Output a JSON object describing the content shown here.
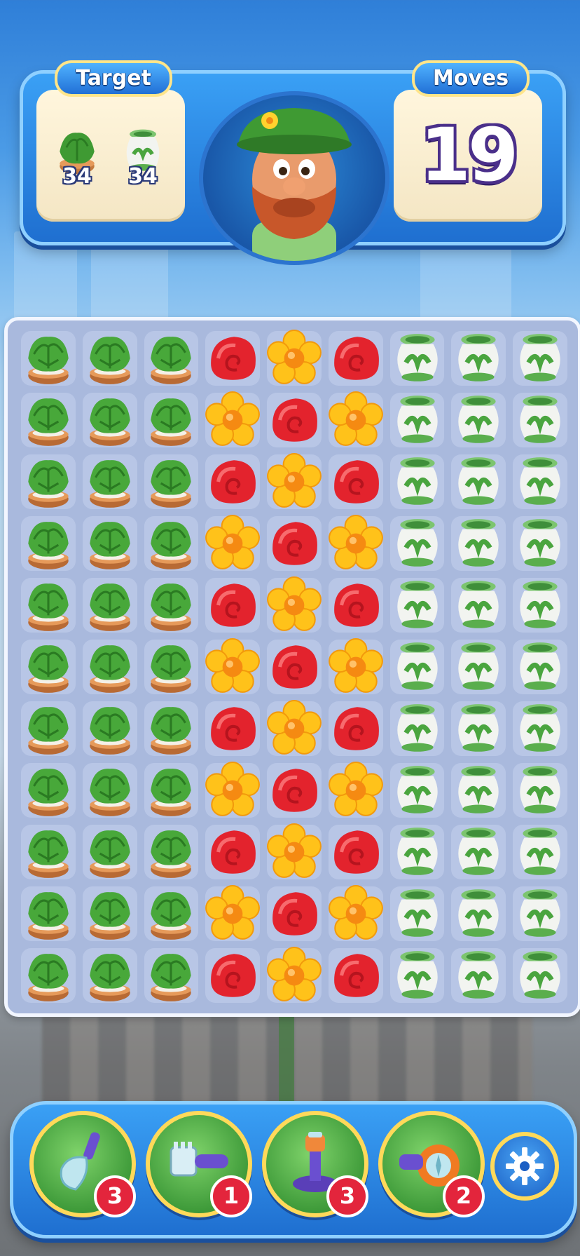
{
  "header": {
    "target_label": "Target",
    "moves_label": "Moves",
    "moves_value": "19",
    "targets": [
      {
        "icon": "potted-plant-icon",
        "count": "34"
      },
      {
        "icon": "green-vase-icon",
        "count": "34"
      }
    ]
  },
  "board": {
    "rows": 11,
    "cols": 9,
    "pattern": [
      [
        "plant",
        "plant",
        "plant",
        "red",
        "yellow",
        "red",
        "vase",
        "vase",
        "vase"
      ],
      [
        "plant",
        "plant",
        "plant",
        "yellow",
        "red",
        "yellow",
        "vase",
        "vase",
        "vase"
      ],
      [
        "plant",
        "plant",
        "plant",
        "red",
        "yellow",
        "red",
        "vase",
        "vase",
        "vase"
      ],
      [
        "plant",
        "plant",
        "plant",
        "yellow",
        "red",
        "yellow",
        "vase",
        "vase",
        "vase"
      ],
      [
        "plant",
        "plant",
        "plant",
        "red",
        "yellow",
        "red",
        "vase",
        "vase",
        "vase"
      ],
      [
        "plant",
        "plant",
        "plant",
        "yellow",
        "red",
        "yellow",
        "vase",
        "vase",
        "vase"
      ],
      [
        "plant",
        "plant",
        "plant",
        "red",
        "yellow",
        "red",
        "vase",
        "vase",
        "vase"
      ],
      [
        "plant",
        "plant",
        "plant",
        "yellow",
        "red",
        "yellow",
        "vase",
        "vase",
        "vase"
      ],
      [
        "plant",
        "plant",
        "plant",
        "red",
        "yellow",
        "red",
        "vase",
        "vase",
        "vase"
      ],
      [
        "plant",
        "plant",
        "plant",
        "yellow",
        "red",
        "yellow",
        "vase",
        "vase",
        "vase"
      ],
      [
        "plant",
        "plant",
        "plant",
        "red",
        "yellow",
        "red",
        "vase",
        "vase",
        "vase"
      ]
    ]
  },
  "boosters": [
    {
      "icon": "shovel-icon",
      "count": "3"
    },
    {
      "icon": "rake-icon",
      "count": "1"
    },
    {
      "icon": "sprinkler-icon",
      "count": "3"
    },
    {
      "icon": "blower-icon",
      "count": "2"
    }
  ],
  "settings_icon": "gear-icon",
  "colors": {
    "panel_blue": "#1f6fd0",
    "card_cream": "#fff6dd",
    "badge_red": "#e3253c",
    "booster_rim": "#ffd95a"
  }
}
